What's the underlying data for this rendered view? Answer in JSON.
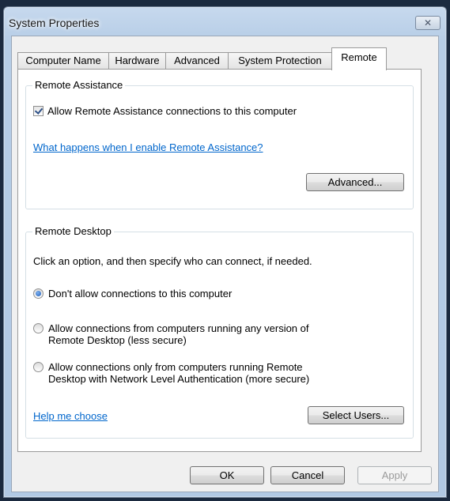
{
  "window": {
    "title": "System Properties"
  },
  "tabs": [
    {
      "label": "Computer Name"
    },
    {
      "label": "Hardware"
    },
    {
      "label": "Advanced"
    },
    {
      "label": "System Protection"
    },
    {
      "label": "Remote"
    }
  ],
  "remote_assistance": {
    "group_title": "Remote Assistance",
    "allow_label": "Allow Remote Assistance connections to this computer",
    "allow_checked": true,
    "help_link": "What happens when I enable Remote Assistance?",
    "advanced_button": "Advanced..."
  },
  "remote_desktop": {
    "group_title": "Remote Desktop",
    "instruction": "Click an option, and then specify who can connect, if needed.",
    "options": [
      {
        "line1": "Don't allow connections to this computer",
        "line2": "",
        "selected": true
      },
      {
        "line1": "Allow connections from computers running any version of",
        "line2": "Remote Desktop (less secure)",
        "selected": false
      },
      {
        "line1": "Allow connections only from computers running Remote",
        "line2": "Desktop with Network Level Authentication (more secure)",
        "selected": false
      }
    ],
    "help_link": "Help me choose",
    "select_users_button": "Select Users..."
  },
  "footer": {
    "ok": "OK",
    "cancel": "Cancel",
    "apply": "Apply"
  }
}
